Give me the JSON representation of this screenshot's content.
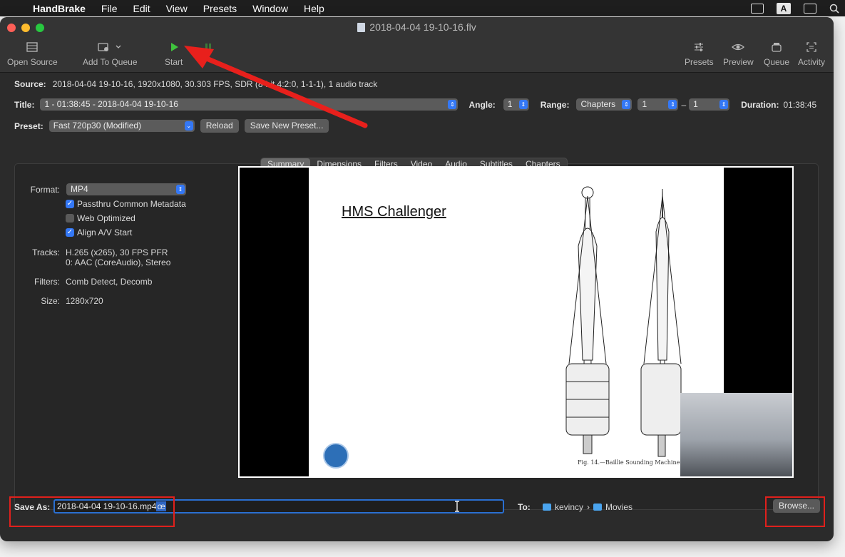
{
  "menubar": {
    "app": "HandBrake",
    "items": [
      "File",
      "Edit",
      "View",
      "Presets",
      "Window",
      "Help"
    ],
    "input_indicator": "A"
  },
  "window": {
    "title": "2018-04-04 19-10-16.flv"
  },
  "toolbar": {
    "open_source": "Open Source",
    "add_to_queue": "Add To Queue",
    "start": "Start",
    "presets": "Presets",
    "preview": "Preview",
    "queue": "Queue",
    "activity": "Activity"
  },
  "source": {
    "label": "Source:",
    "value": "2018-04-04 19-10-16, 1920x1080, 30.303 FPS, SDR (8-bit 4:2:0, 1-1-1), 1 audio track"
  },
  "title_row": {
    "label": "Title:",
    "value": "1 - 01:38:45 - 2018-04-04 19-10-16",
    "angle_label": "Angle:",
    "angle_value": "1",
    "range_label": "Range:",
    "range_value": "Chapters",
    "range_from": "1",
    "range_sep": "–",
    "range_to": "1",
    "duration_label": "Duration:",
    "duration_value": "01:38:45"
  },
  "preset_row": {
    "label": "Preset:",
    "value": "Fast 720p30 (Modified)",
    "reload": "Reload",
    "save_new": "Save New Preset..."
  },
  "tabs": [
    "Summary",
    "Dimensions",
    "Filters",
    "Video",
    "Audio",
    "Subtitles",
    "Chapters"
  ],
  "summary": {
    "format_label": "Format:",
    "format_value": "MP4",
    "checks": [
      {
        "label": "Passthru Common Metadata",
        "checked": true
      },
      {
        "label": "Web Optimized",
        "checked": false
      },
      {
        "label": "Align A/V Start",
        "checked": true
      }
    ],
    "tracks_label": "Tracks:",
    "tracks_line1": "H.265 (x265), 30 FPS PFR",
    "tracks_line2": "0: AAC (CoreAudio), Stereo",
    "filters_label": "Filters:",
    "filters_value": "Comb Detect, Decomb",
    "size_label": "Size:",
    "size_value": "1280x720"
  },
  "preview": {
    "slide_title": "HMS Challenger",
    "caption": "Fig. 14.—Baillie Sounding Machine."
  },
  "save": {
    "label": "Save As:",
    "filename": "2018-04-04 19-10-16.mp4",
    "typed": "œ",
    "to_label": "To:",
    "path": [
      "kevincy",
      "Movies"
    ],
    "browse": "Browse..."
  }
}
